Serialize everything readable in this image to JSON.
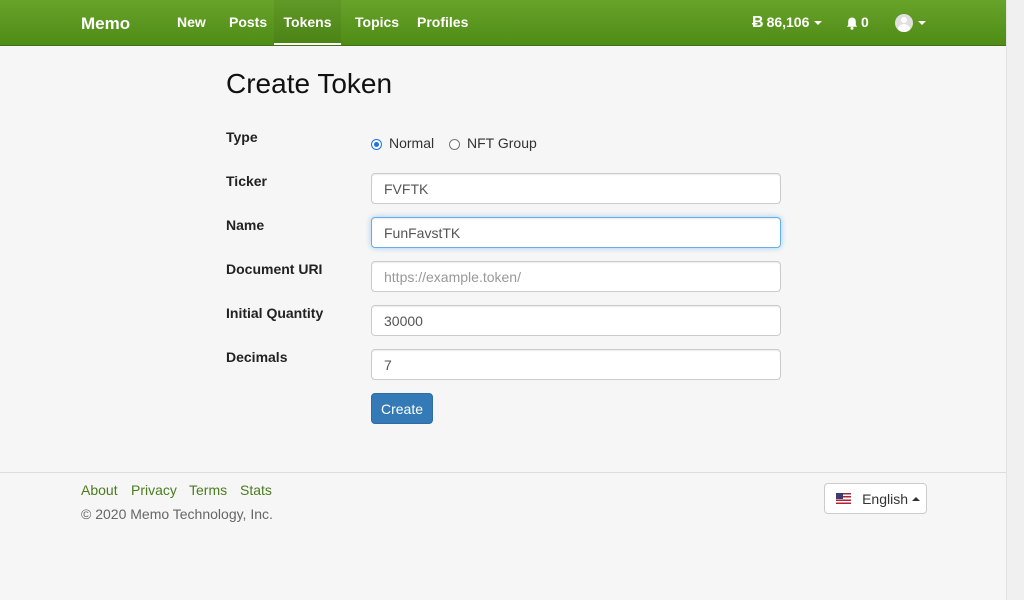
{
  "navbar": {
    "brand": "Memo",
    "items": [
      {
        "label": "New"
      },
      {
        "label": "Posts"
      },
      {
        "label": "Tokens",
        "active": true
      },
      {
        "label": "Topics"
      },
      {
        "label": "Profiles"
      }
    ],
    "balance": "86,106",
    "balance_icon": "bitcoin-cash-icon",
    "notifications": "0",
    "notifications_icon": "bell-icon",
    "profile_icon": "avatar-icon",
    "color": "#5a9a1f"
  },
  "form": {
    "title": "Create Token",
    "type_label": "Type",
    "type_options": [
      {
        "label": "Normal",
        "checked": true
      },
      {
        "label": "NFT Group",
        "checked": false
      }
    ],
    "ticker_label": "Ticker",
    "ticker_value": "FVFTK",
    "name_label": "Name",
    "name_value": "FunFavstTK",
    "doc_uri_label": "Document URI",
    "doc_uri_value": "",
    "doc_uri_placeholder": "https://example.token/",
    "quantity_label": "Initial Quantity",
    "quantity_value": "30000",
    "decimals_label": "Decimals",
    "decimals_value": "7",
    "submit_label": "Create",
    "submit_color": "#337ab7"
  },
  "footer": {
    "links": [
      {
        "label": "About"
      },
      {
        "label": "Privacy"
      },
      {
        "label": "Terms"
      },
      {
        "label": "Stats"
      }
    ],
    "copyright": "© 2020 Memo Technology, Inc.",
    "language": "English",
    "language_icon": "us-flag-icon",
    "link_color": "#4a7c1e"
  }
}
